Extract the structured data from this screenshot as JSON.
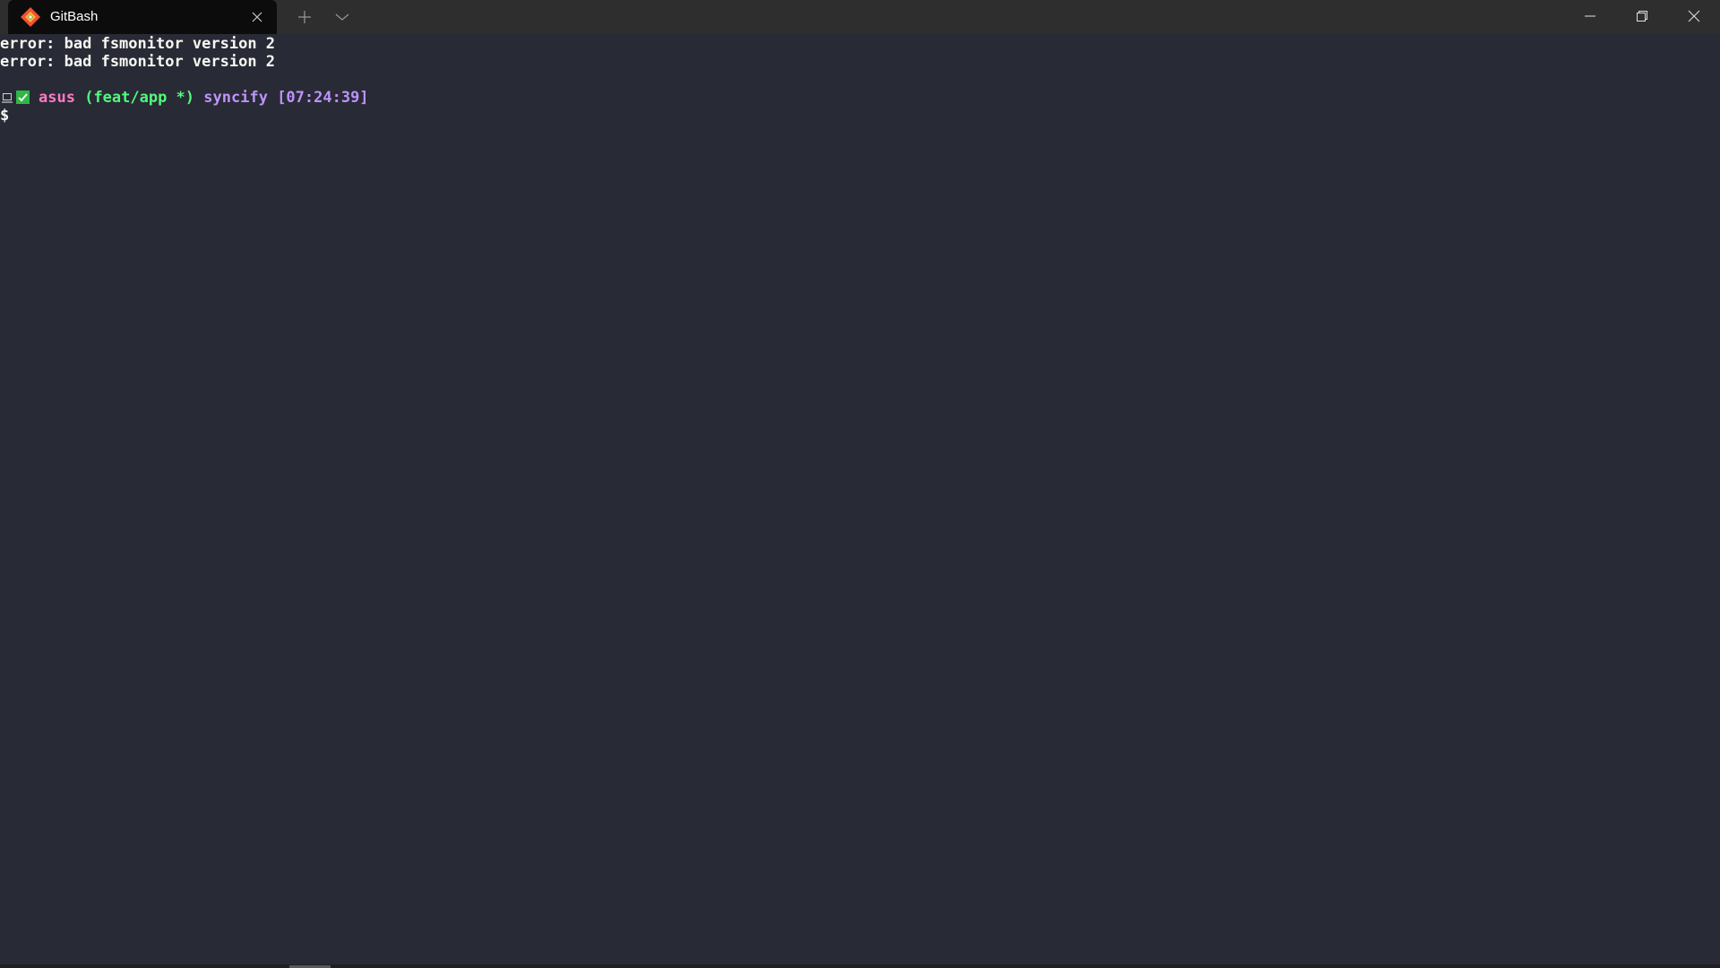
{
  "window": {
    "tab_title": "GitBash",
    "tab_icon": "git-bash-icon",
    "new_tab_icon": "plus-icon",
    "dropdown_icon": "chevron-down-icon",
    "minimize_icon": "minimize-icon",
    "restore_icon": "restore-icon",
    "close_icon": "close-icon"
  },
  "terminal": {
    "background": "#282a36",
    "output": [
      "error: bad fsmonitor version 2",
      "error: bad fsmonitor version 2"
    ],
    "prompt": {
      "user": "asus",
      "branch": "(feat/app *)",
      "directory": "syncify",
      "time": "[07:24:39]",
      "symbol": "$",
      "colors": {
        "user": "#ff79c6",
        "branch": "#50fa7b",
        "directory": "#bd93f9",
        "time": "#bd93f9",
        "status_check": "#2eb844"
      }
    }
  }
}
